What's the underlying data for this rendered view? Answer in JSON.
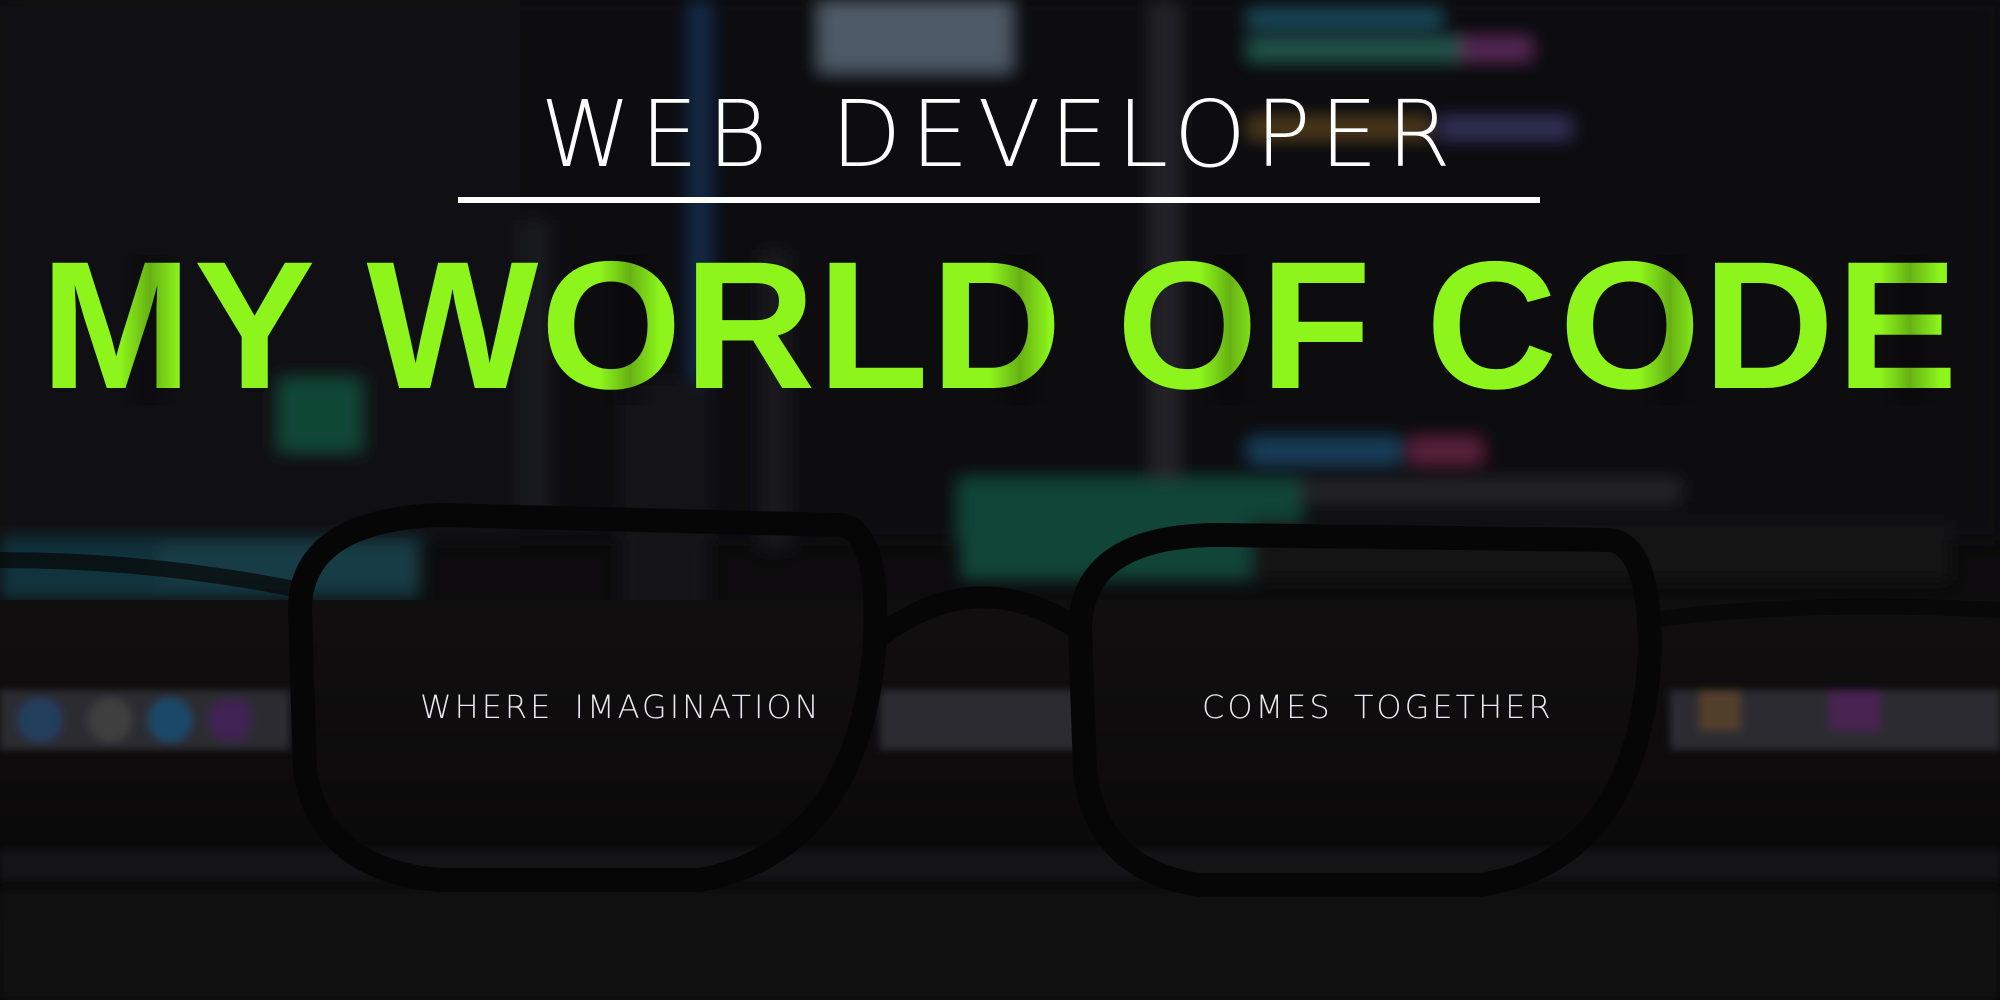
{
  "heading": {
    "subtitle": "WEB DEVELOPER",
    "title": "MY WORLD OF CODE"
  },
  "tagline": {
    "left": "WHERE IMAGINATION",
    "right": "COMES TOGETHER"
  },
  "colors": {
    "accent": "#8df51b",
    "text": "#ffffff",
    "background": "#141214"
  }
}
